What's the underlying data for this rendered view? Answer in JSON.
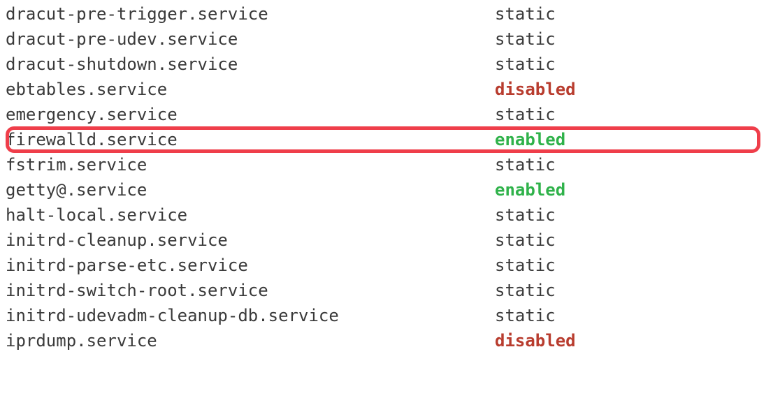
{
  "services": [
    {
      "name": "dracut-pre-trigger.service",
      "status": "static",
      "state": "static",
      "highlighted": false
    },
    {
      "name": "dracut-pre-udev.service",
      "status": "static",
      "state": "static",
      "highlighted": false
    },
    {
      "name": "dracut-shutdown.service",
      "status": "static",
      "state": "static",
      "highlighted": false
    },
    {
      "name": "ebtables.service",
      "status": "disabled",
      "state": "disabled",
      "highlighted": false
    },
    {
      "name": "emergency.service",
      "status": "static",
      "state": "static",
      "highlighted": false
    },
    {
      "name": "firewalld.service",
      "status": "enabled",
      "state": "enabled",
      "highlighted": true
    },
    {
      "name": "fstrim.service",
      "status": "static",
      "state": "static",
      "highlighted": false
    },
    {
      "name": "getty@.service",
      "status": "enabled",
      "state": "enabled",
      "highlighted": false
    },
    {
      "name": "halt-local.service",
      "status": "static",
      "state": "static",
      "highlighted": false
    },
    {
      "name": "initrd-cleanup.service",
      "status": "static",
      "state": "static",
      "highlighted": false
    },
    {
      "name": "initrd-parse-etc.service",
      "status": "static",
      "state": "static",
      "highlighted": false
    },
    {
      "name": "initrd-switch-root.service",
      "status": "static",
      "state": "static",
      "highlighted": false
    },
    {
      "name": "initrd-udevadm-cleanup-db.service",
      "status": "static",
      "state": "static",
      "highlighted": false
    },
    {
      "name": "iprdump.service",
      "status": "disabled",
      "state": "disabled",
      "highlighted": false
    }
  ]
}
